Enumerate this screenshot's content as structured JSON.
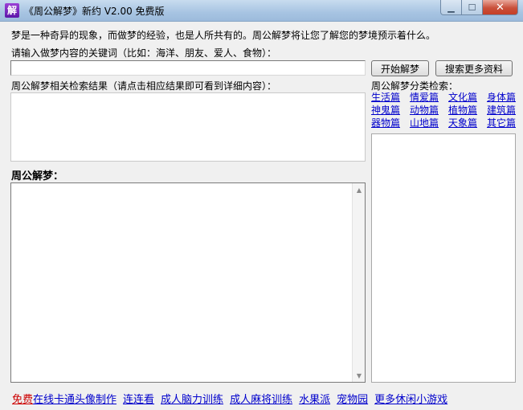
{
  "window": {
    "app_icon_glyph": "解",
    "title": "《周公解梦》新约 V2.00 免费版",
    "min_glyph": "▁",
    "max_glyph": "☐",
    "close_glyph": "✕"
  },
  "intro_text": "梦是一种奇异的现象，而做梦的经验，也是人所共有的。周公解梦将让您了解您的梦境预示着什么。",
  "keyword": {
    "label": "请输入做梦内容的关键词（比如：海洋、朋友、爱人、食物）：",
    "value": ""
  },
  "buttons": {
    "start": "开始解梦",
    "search_more": "搜索更多资料"
  },
  "results": {
    "label": "周公解梦相关检索结果（请点击相应结果即可看到详细内容）："
  },
  "categories": {
    "label": "周公解梦分类检索：",
    "rows": [
      [
        "生活篇",
        "情爱篇",
        "文化篇",
        "身体篇"
      ],
      [
        "神鬼篇",
        "动物篇",
        "植物篇",
        "建筑篇"
      ],
      [
        "器物篇",
        "山地篇",
        "天象篇",
        "其它篇"
      ]
    ]
  },
  "dream": {
    "label": "周公解梦："
  },
  "scrollbar": {
    "up_glyph": "▲",
    "down_glyph": "▼"
  },
  "bottom_links": {
    "free": "免费",
    "items": [
      "在线卡通头像制作",
      "连连看",
      "成人脑力训练",
      "成人麻将训练",
      "水果派",
      "宠物园",
      "更多休闲小游戏"
    ]
  }
}
